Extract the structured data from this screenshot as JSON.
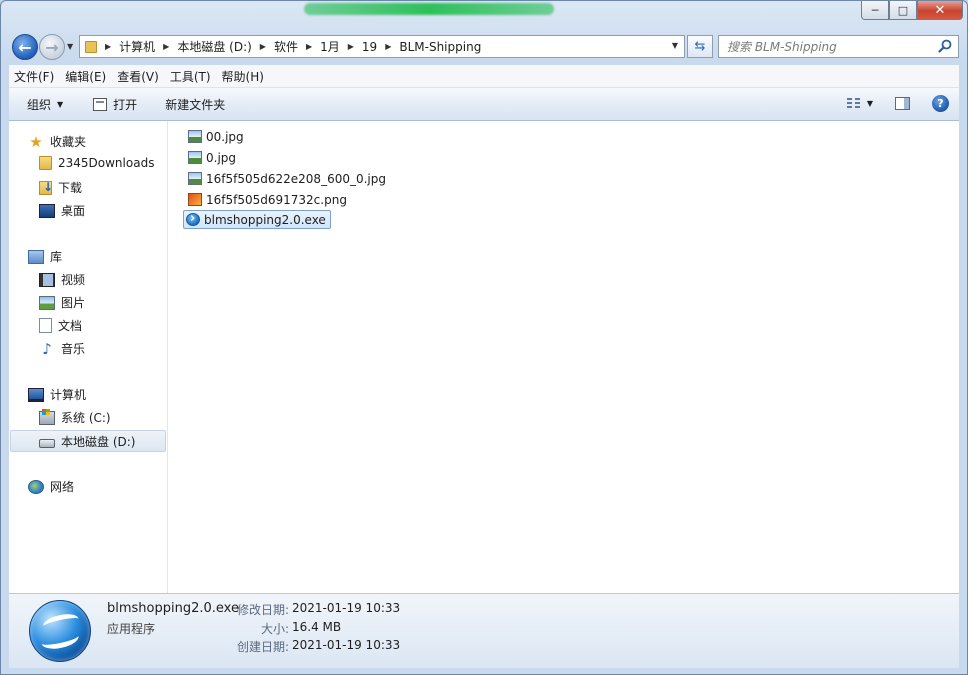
{
  "window": {
    "caption_min": "─",
    "caption_max": "□",
    "caption_close": "✕"
  },
  "address": {
    "crumbs": [
      "计算机",
      "本地磁盘 (D:)",
      "软件",
      "1月",
      "19",
      "BLM-Shipping"
    ],
    "search_placeholder": "搜索 BLM-Shipping"
  },
  "menu": {
    "items": [
      "文件(F)",
      "编辑(E)",
      "查看(V)",
      "工具(T)",
      "帮助(H)"
    ]
  },
  "toolbar": {
    "organize": "组织",
    "open": "打开",
    "new_folder": "新建文件夹"
  },
  "nav": {
    "favorites": "收藏夹",
    "downloads2345": "2345Downloads",
    "downloads": "下载",
    "desktop": "桌面",
    "libraries": "库",
    "videos": "视频",
    "pictures": "图片",
    "documents": "文档",
    "music": "音乐",
    "computer": "计算机",
    "drive_c": "系统 (C:)",
    "drive_d": "本地磁盘 (D:)",
    "network": "网络"
  },
  "files": [
    {
      "name": "00.jpg",
      "type": "jpg"
    },
    {
      "name": "0.jpg",
      "type": "jpg"
    },
    {
      "name": "16f5f505d622e208_600_0.jpg",
      "type": "jpg"
    },
    {
      "name": "16f5f505d691732c.png",
      "type": "png"
    },
    {
      "name": "blmshopping2.0.exe",
      "type": "exe"
    }
  ],
  "details": {
    "name": "blmshopping2.0.exe",
    "type": "应用程序",
    "modified_label": "修改日期:",
    "modified_value": "2021-01-19 10:33",
    "size_label": "大小:",
    "size_value": "16.4 MB",
    "created_label": "创建日期:",
    "created_value": "2021-01-19 10:33"
  }
}
